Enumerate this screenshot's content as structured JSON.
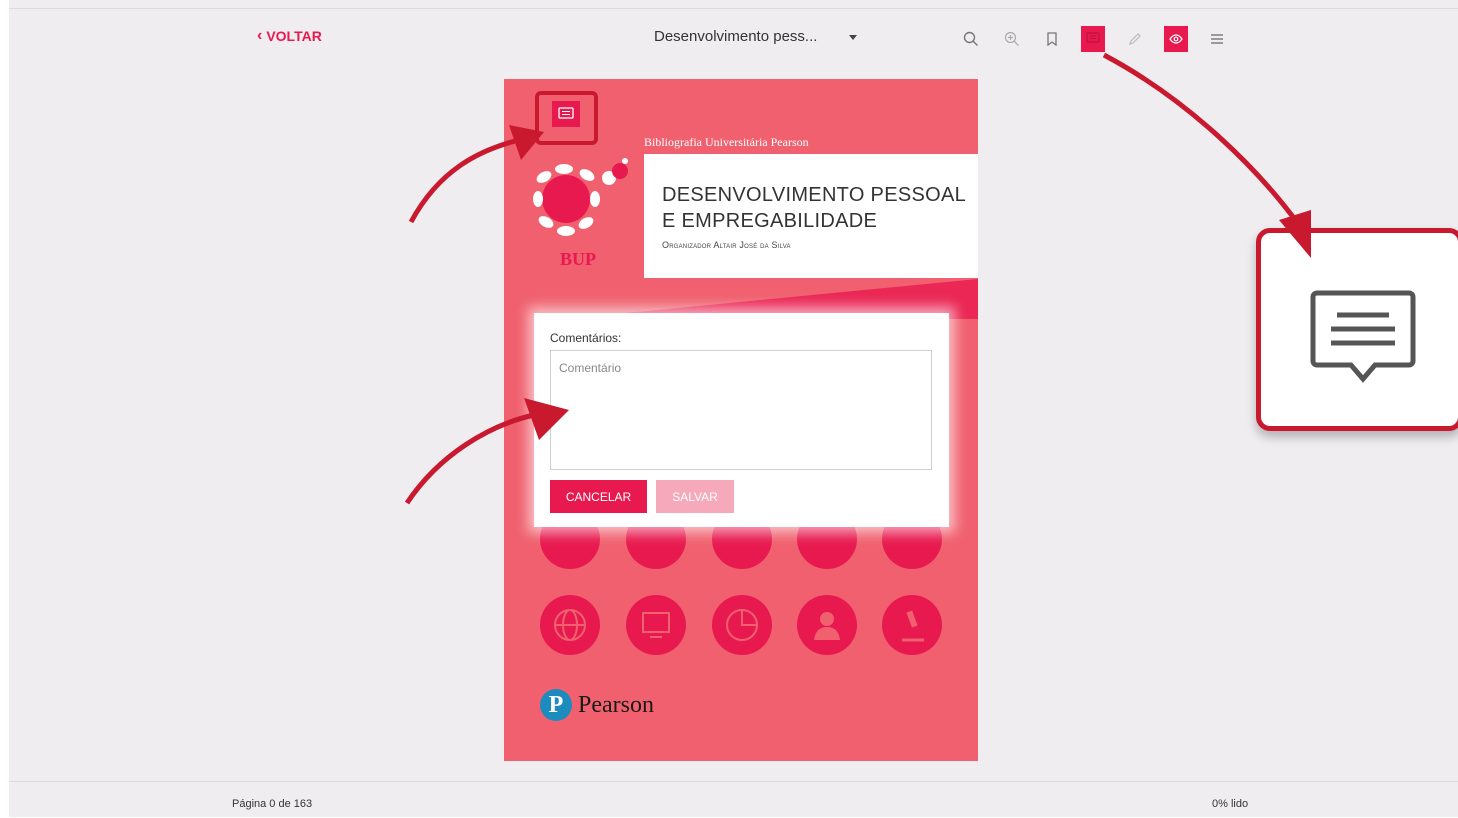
{
  "header": {
    "back_label": "VOLTAR",
    "book_title": "Desenvolvimento pess...",
    "toolbar": [
      "search-icon",
      "zoom-in-icon",
      "bookmark-icon",
      "comment-icon",
      "pencil-icon",
      "eye-icon",
      "menu-icon"
    ]
  },
  "book": {
    "biblio": "Bibliografia Universitária Pearson",
    "title_line1": "DESENVOLVIMENTO PESSOAL",
    "title_line2": "E EMPREGABILIDADE",
    "organizer": "Organizador Altair José da Silva",
    "logo_text": "BUP",
    "publisher": "Pearson",
    "publisher_initial": "P"
  },
  "comment": {
    "label": "Comentários:",
    "placeholder": "Comentário",
    "cancel_label": "CANCELAR",
    "save_label": "SALVAR"
  },
  "footer": {
    "page_info": "Página 0 de 163",
    "read_info": "0% lido"
  },
  "colors": {
    "accent": "#e8194f",
    "cover": "#f0606e",
    "callout_red": "#c8192f"
  }
}
